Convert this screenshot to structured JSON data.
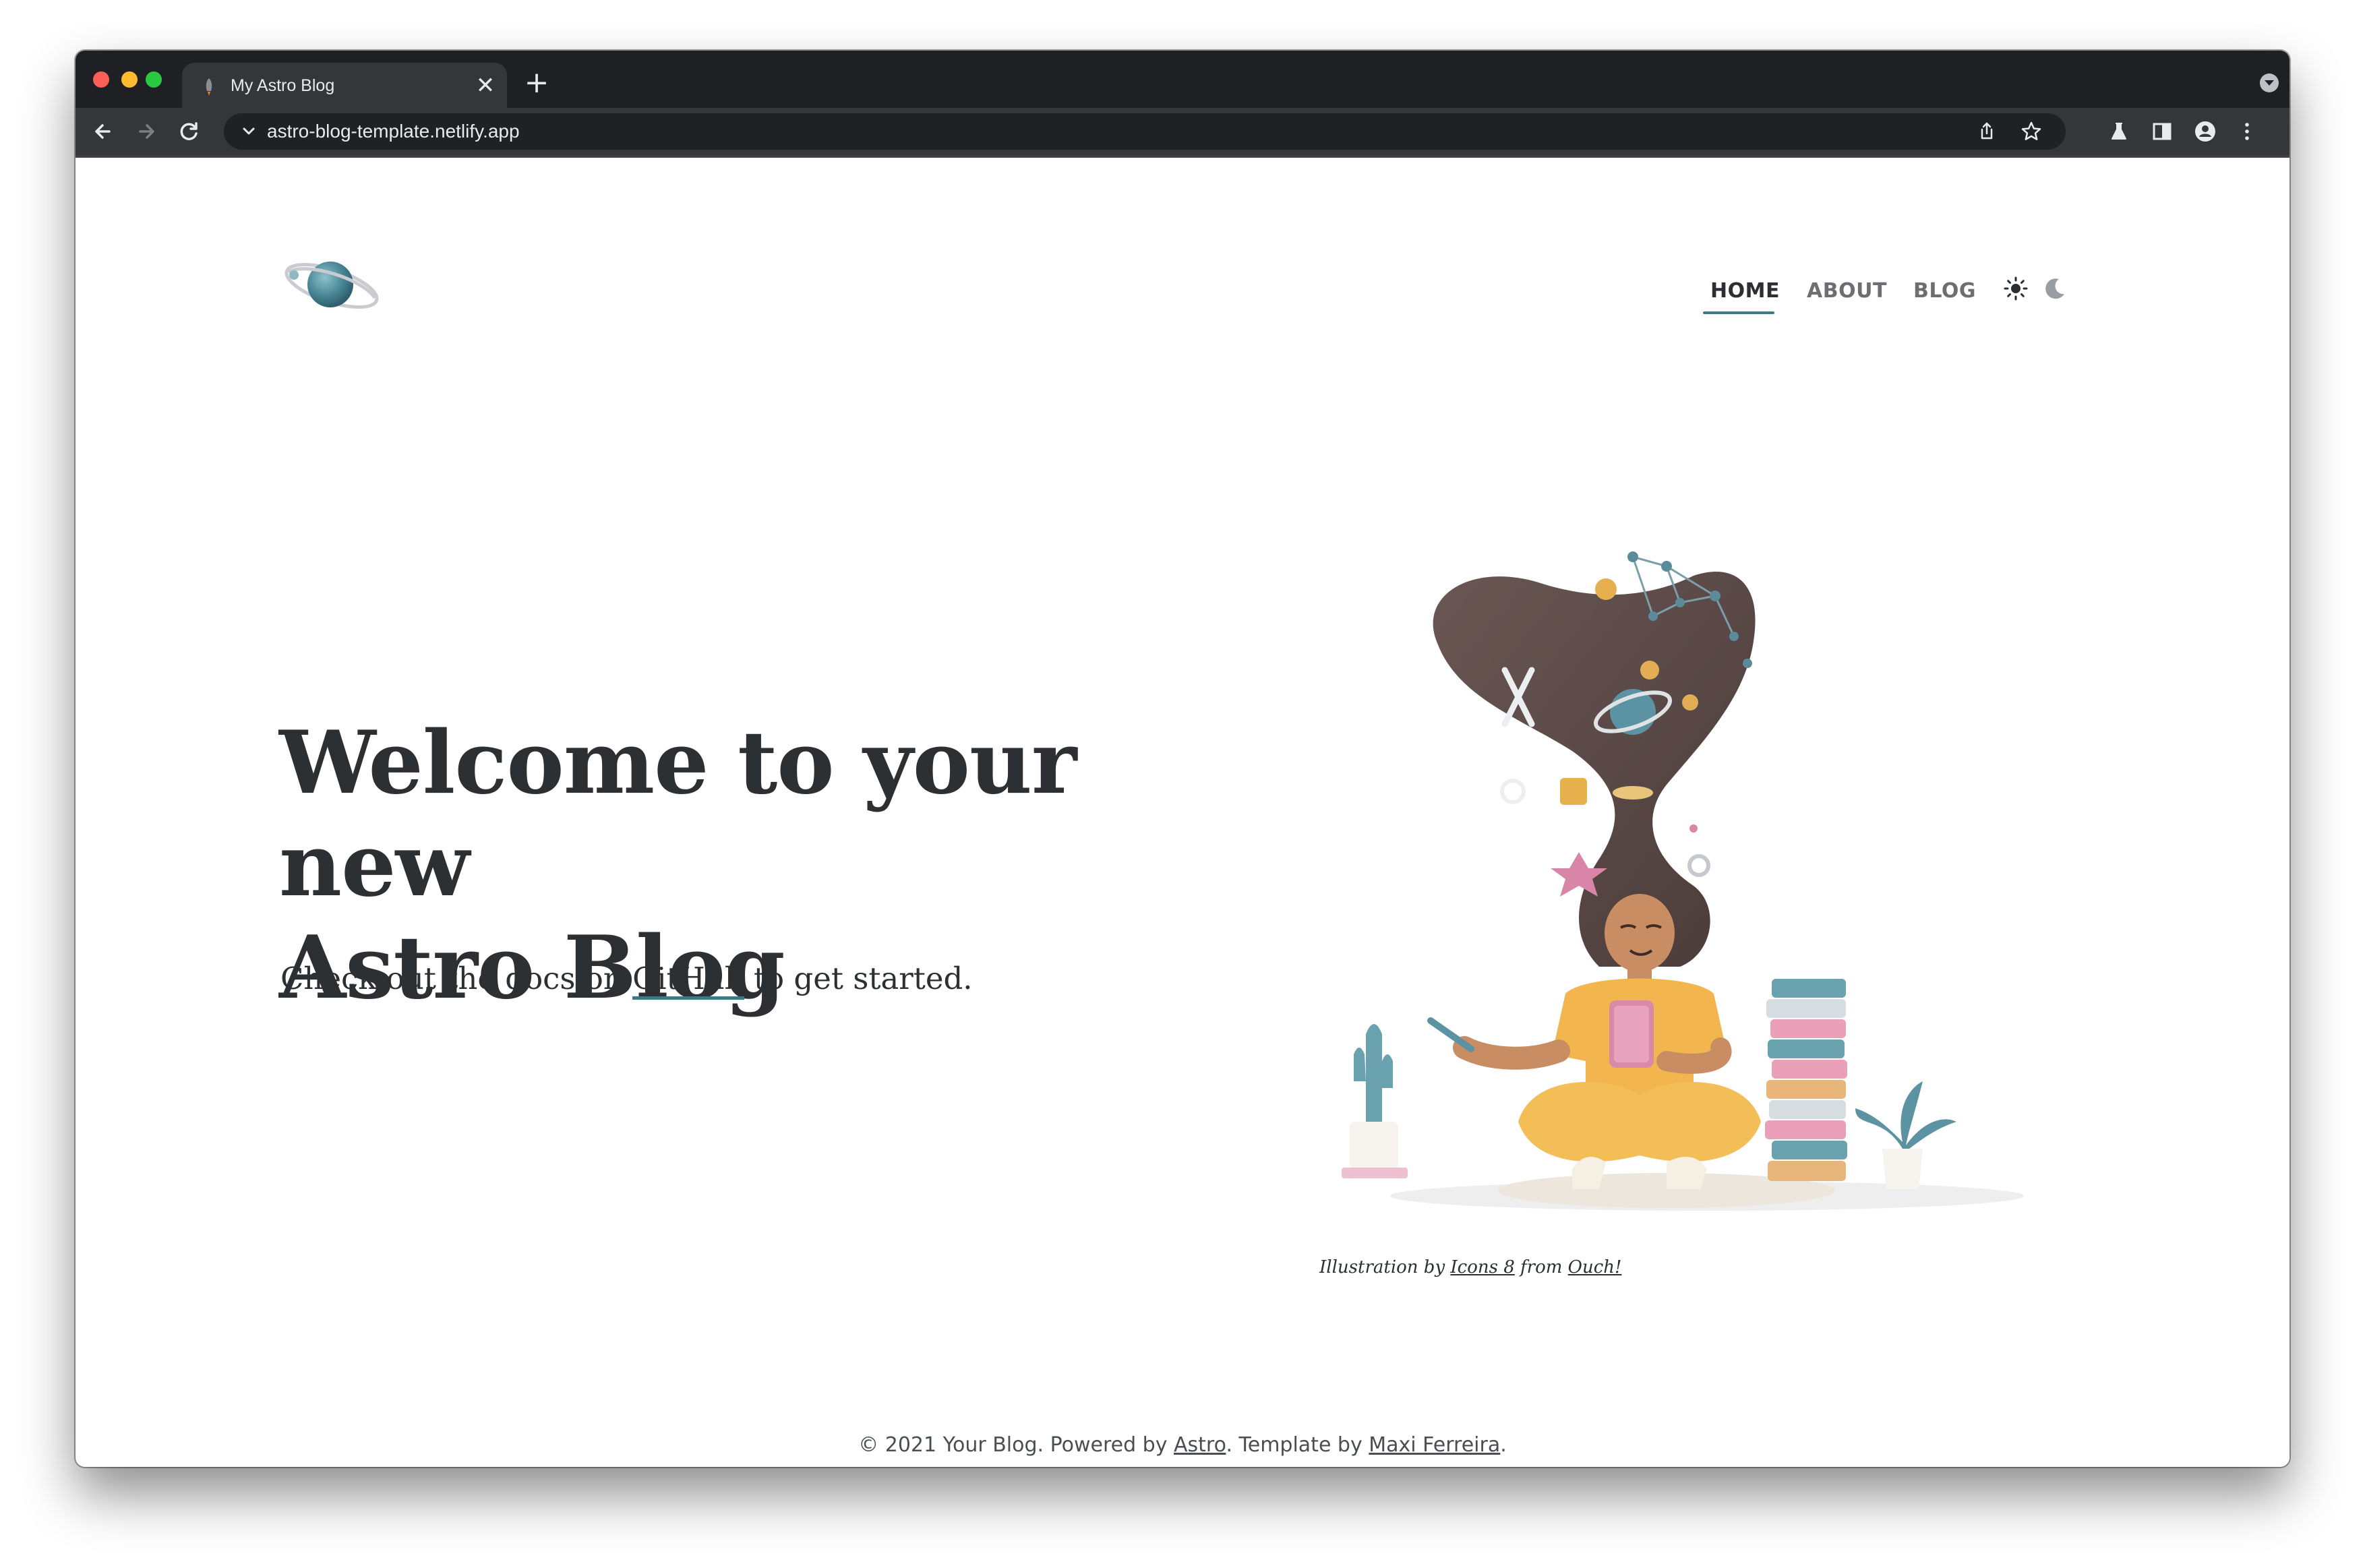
{
  "browser": {
    "tab_title": "My Astro Blog",
    "tab_close": "✕",
    "new_tab": "+",
    "url": "astro-blog-template.netlify.app"
  },
  "nav": {
    "items": [
      {
        "label": "HOME",
        "active": true
      },
      {
        "label": "ABOUT",
        "active": false
      },
      {
        "label": "BLOG",
        "active": false
      }
    ],
    "theme_icons": [
      "sun-icon",
      "moon-icon"
    ]
  },
  "hero": {
    "title_line1": "Welcome to your new",
    "title_line2": "Astro Blog",
    "subtitle_before": "Check out the docs on ",
    "subtitle_link": "GitHub",
    "subtitle_after": " to get started."
  },
  "illustration": {
    "caption_prefix": "Illustration by ",
    "caption_link1": "Icons 8",
    "caption_middle": " from ",
    "caption_link2": "Ouch!"
  },
  "footer": {
    "prefix": "© 2021 Your Blog. Powered by ",
    "link1": "Astro",
    "middle": ". Template by ",
    "link2": "Maxi Ferreira",
    "suffix": "."
  },
  "colors": {
    "accent": "#3d7a86",
    "text": "#2d3033",
    "chrome_dark": "#1f2023",
    "chrome_toolbar": "#35363a"
  }
}
